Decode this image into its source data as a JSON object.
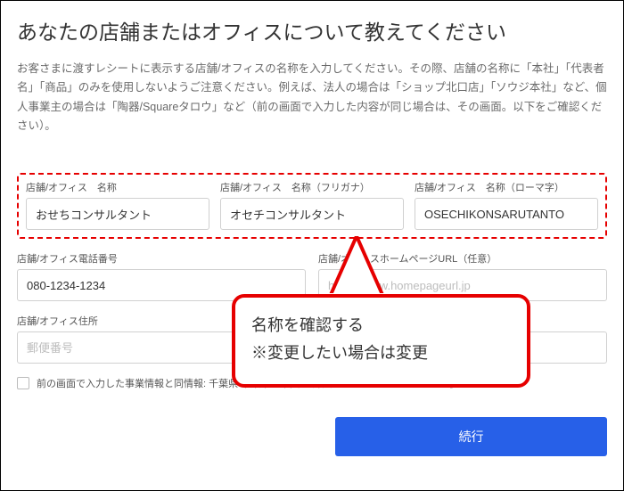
{
  "heading": "あなたの店舗またはオフィスについて教えてください",
  "description": "お客さまに渡すレシートに表示する店舗/オフィスの名称を入力してください。その際、店舗の名称に「本社」「代表者名」「商品」のみを使用しないようご注意ください。例えば、法人の場合は「ショップ北口店」「ソウジ本社」など、個人事業主の場合は「陶器/Squareタロウ」など（前の画面で入力した内容が同じ場合は、その画面。以下をご確認ください）。",
  "fields": {
    "name": {
      "label": "店舗/オフィス　名称",
      "value": "おせちコンサルタント"
    },
    "furigana": {
      "label": "店舗/オフィス　名称（フリガナ）",
      "value": "オセチコンサルタント"
    },
    "romaji": {
      "label": "店舗/オフィス　名称（ローマ字）",
      "value": "OSECHIKONSARUTANTO"
    },
    "phone": {
      "label": "店舗/オフィス電話番号",
      "value": "080-1234-1234"
    },
    "url": {
      "label": "店舗/オフィスホームページURL（任意）",
      "placeholder": "https://www.homepageurl.jp"
    },
    "address": {
      "label": "店舗/オフィス住所",
      "placeholder": "郵便番号"
    }
  },
  "checkbox": {
    "label": "前の画面で入力した事業情報と同情報: 千葉県 千葉市　中央区 弁天 4-88-10 パークハイツ406号室"
  },
  "submit": "続行",
  "callout": {
    "line1": "名称を確認する",
    "line2": "※変更したい場合は変更"
  }
}
